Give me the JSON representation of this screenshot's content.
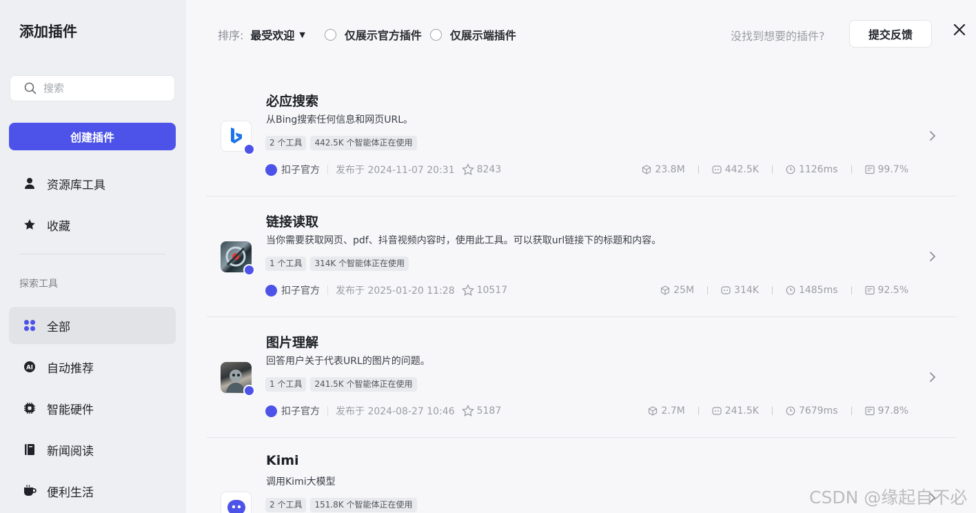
{
  "sidebar": {
    "title": "添加插件",
    "search_placeholder": "搜索",
    "create_label": "创建插件",
    "items": [
      {
        "label": "资源库工具",
        "icon": "person-icon"
      },
      {
        "label": "收藏",
        "icon": "star-icon"
      }
    ],
    "section_label": "探索工具",
    "categories": [
      {
        "label": "全部",
        "icon": "grid-icon",
        "active": true
      },
      {
        "label": "自动推荐",
        "icon": "ai-icon"
      },
      {
        "label": "智能硬件",
        "icon": "chip-icon"
      },
      {
        "label": "新闻阅读",
        "icon": "book-icon"
      },
      {
        "label": "便利生活",
        "icon": "cup-icon"
      }
    ]
  },
  "topbar": {
    "sort_label": "排序:",
    "sort_value": "最受欢迎",
    "filter_official": "仅展示官方插件",
    "filter_client": "仅展示端插件",
    "not_found": "没找到想要的插件?",
    "feedback_label": "提交反馈"
  },
  "plugins": [
    {
      "name": "必应搜索",
      "desc": "从Bing搜索任何信息和网页URL。",
      "tools": "2 个工具",
      "usage": "442.5K 个智能体正在使用",
      "official": "扣子官方",
      "published": "发布于 2024-11-07 20:31",
      "stars": "8243",
      "calls": "23.8M",
      "bots": "442.5K",
      "latency": "1126ms",
      "success": "99.7%"
    },
    {
      "name": "链接读取",
      "desc": "当你需要获取网页、pdf、抖音视频内容时，使用此工具。可以获取url链接下的标题和内容。",
      "tools": "1 个工具",
      "usage": "314K 个智能体正在使用",
      "official": "扣子官方",
      "published": "发布于 2025-01-20 11:28",
      "stars": "10517",
      "calls": "25M",
      "bots": "314K",
      "latency": "1485ms",
      "success": "92.5%"
    },
    {
      "name": "图片理解",
      "desc": "回答用户关于代表URL的图片的问题。",
      "tools": "1 个工具",
      "usage": "241.5K 个智能体正在使用",
      "official": "扣子官方",
      "published": "发布于 2024-08-27 10:46",
      "stars": "5187",
      "calls": "2.7M",
      "bots": "241.5K",
      "latency": "7679ms",
      "success": "97.8%"
    },
    {
      "name": "Kimi",
      "desc": "调用Kimi大模型",
      "tools": "2 个工具",
      "usage": "151.8K 个智能体正在使用"
    }
  ],
  "watermark": "CSDN @缘起自不必",
  "colors": {
    "accent": "#4d53e8",
    "sidebar_bg": "#eeeff2",
    "main_bg": "#f7f7f9"
  }
}
